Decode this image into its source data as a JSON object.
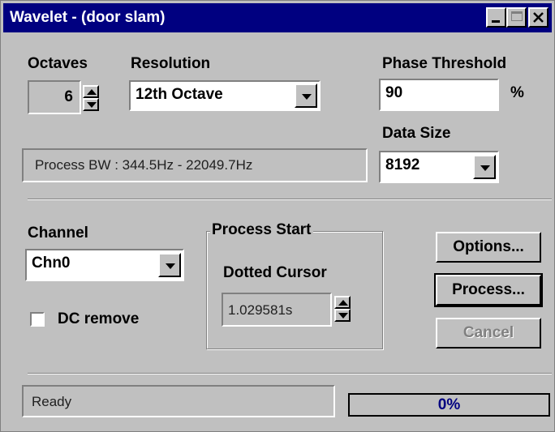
{
  "window": {
    "title": "Wavelet - (door slam)"
  },
  "octaves": {
    "label": "Octaves",
    "value": "6"
  },
  "resolution": {
    "label": "Resolution",
    "value": "12th Octave"
  },
  "phase_threshold": {
    "label": "Phase Threshold",
    "value": "90",
    "unit": "%"
  },
  "process_bw": {
    "text": "Process BW : 344.5Hz - 22049.7Hz"
  },
  "data_size": {
    "label": "Data Size",
    "value": "8192"
  },
  "channel": {
    "label": "Channel",
    "value": "Chn0"
  },
  "dc_remove": {
    "label": "DC remove",
    "checked": false
  },
  "process_start": {
    "title": "Process Start",
    "label": "Dotted Cursor",
    "value": "1.029581s"
  },
  "buttons": {
    "options": "Options...",
    "process": "Process...",
    "cancel": "Cancel"
  },
  "status": {
    "text": "Ready",
    "progress_text": "0%",
    "progress": 0
  }
}
